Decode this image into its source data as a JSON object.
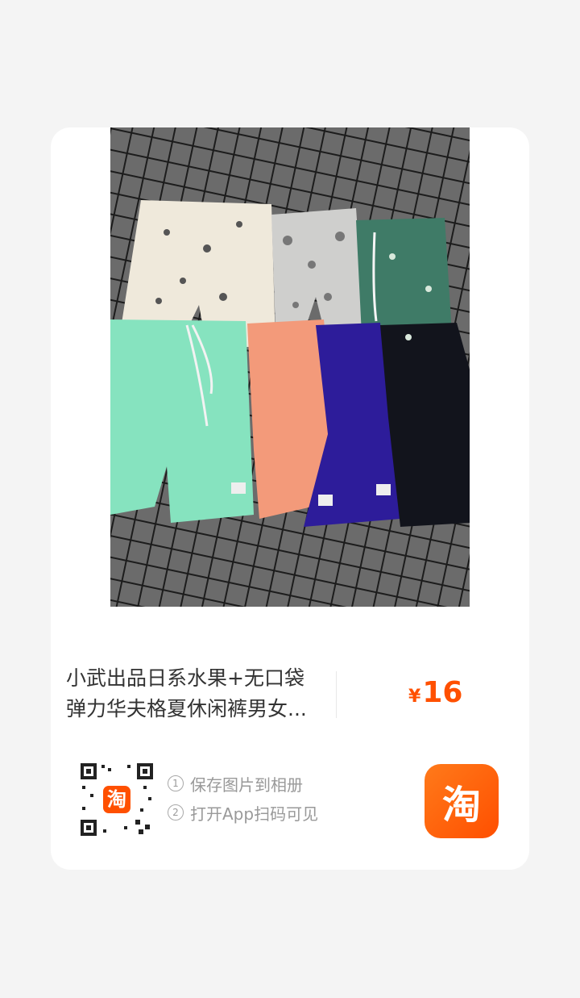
{
  "product": {
    "title_line1": "小武出品日系水果+无口袋",
    "title_line2": "弹力华夫格夏休闲裤男女...",
    "price_symbol": "¥",
    "price_value": "16"
  },
  "instructions": [
    {
      "num": "1",
      "text": "保存图片到相册"
    },
    {
      "num": "2",
      "text": "打开App扫码可见"
    }
  ],
  "logo": {
    "glyph": "淘"
  },
  "colors": {
    "price": "#ff5000",
    "brand": "#ff5000"
  },
  "photo_shorts": [
    {
      "color": "#efe9db",
      "row": "back"
    },
    {
      "color": "#cfcfcd",
      "row": "back"
    },
    {
      "color": "#3f7b67",
      "row": "back"
    },
    {
      "color": "#86e3bf",
      "row": "front"
    },
    {
      "color": "#f39a7a",
      "row": "front"
    },
    {
      "color": "#2d1c9a",
      "row": "front"
    },
    {
      "color": "#12141c",
      "row": "front"
    }
  ]
}
